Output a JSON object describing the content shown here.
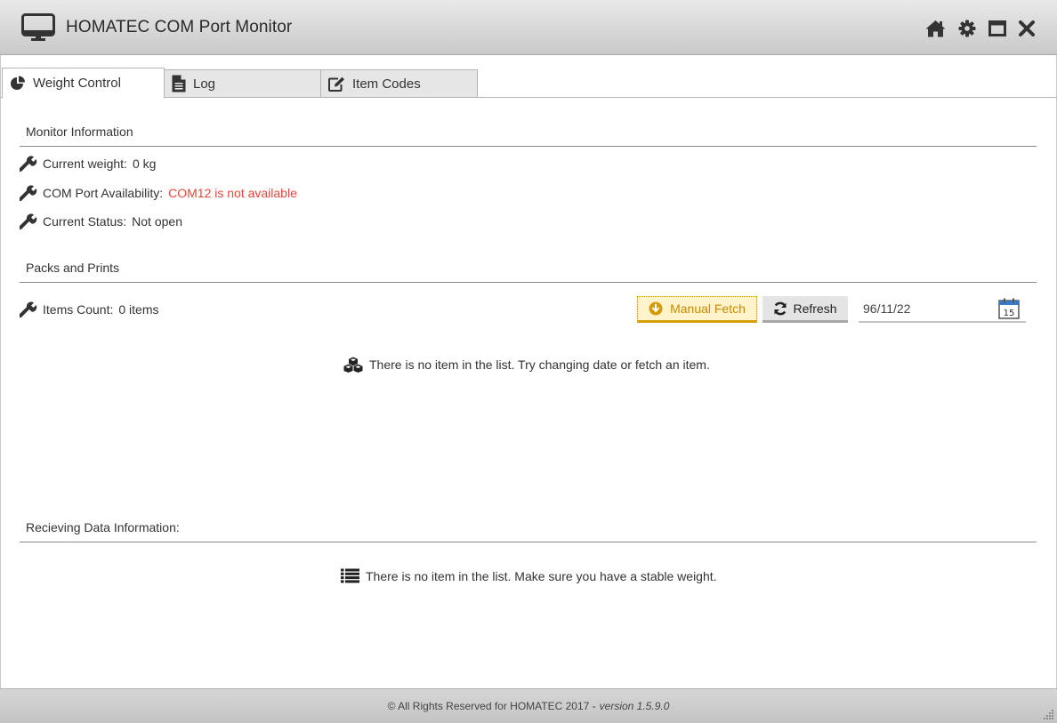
{
  "window": {
    "title": "HOMATEC COM Port Monitor"
  },
  "tabs": [
    {
      "label": "Weight Control",
      "icon": "pie-chart-icon",
      "active": true
    },
    {
      "label": "Log",
      "icon": "document-icon",
      "active": false
    },
    {
      "label": "Item Codes",
      "icon": "edit-icon",
      "active": false
    }
  ],
  "monitor": {
    "section_title": "Monitor Information",
    "current_weight_label": "Current weight:",
    "current_weight_value": "0 kg",
    "com_label": "COM Port Availability:",
    "com_value": "COM12 is not available",
    "status_label": "Current Status:",
    "status_value": "Not open"
  },
  "packs": {
    "section_title": "Packs and Prints",
    "items_count_label": "Items Count:",
    "items_count_value": "0 items",
    "manual_fetch_label": "Manual Fetch",
    "refresh_label": "Refresh",
    "date_value": "96/11/22",
    "calendar_day": "15",
    "empty_message": "There is no item in the list. Try changing date or fetch an item."
  },
  "receiving": {
    "section_title": "Recieving Data Information:",
    "empty_message": "There is no item in the list. Make sure you have a stable weight."
  },
  "footer": {
    "copyright": "© All Rights Reserved for HOMATEC 2017 -",
    "version": "version 1.5.9.0"
  },
  "colors": {
    "error_text": "#e8463a",
    "fetch_accent": "#c98a00",
    "fetch_bg": "#fff3cc"
  }
}
